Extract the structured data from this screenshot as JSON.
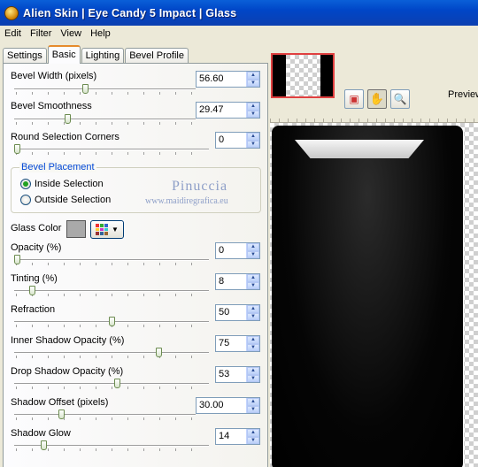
{
  "window": {
    "title": "Alien Skin | Eye Candy 5 Impact | Glass"
  },
  "menu": [
    "Edit",
    "Filter",
    "View",
    "Help"
  ],
  "tabs": [
    "Settings",
    "Basic",
    "Lighting",
    "Bevel Profile"
  ],
  "active_tab": "Basic",
  "controls": {
    "bevel_width": {
      "label": "Bevel Width (pixels)",
      "value": "56.60",
      "level": 0.39
    },
    "bevel_smoothness": {
      "label": "Bevel Smoothness",
      "value": "29.47",
      "level": 0.29
    },
    "round_corners": {
      "label": "Round Selection Corners",
      "value": "0",
      "level": 0.0
    },
    "opacity": {
      "label": "Opacity (%)",
      "value": "0",
      "level": 0.0
    },
    "tinting": {
      "label": "Tinting (%)",
      "value": "8",
      "level": 0.08
    },
    "refraction": {
      "label": "Refraction",
      "value": "50",
      "level": 0.5
    },
    "inner_shadow": {
      "label": "Inner Shadow Opacity (%)",
      "value": "75",
      "level": 0.75
    },
    "drop_shadow": {
      "label": "Drop Shadow Opacity (%)",
      "value": "53",
      "level": 0.53
    },
    "shadow_offset": {
      "label": "Shadow Offset (pixels)",
      "value": "30.00",
      "level": 0.25
    },
    "shadow_glow": {
      "label": "Shadow Glow",
      "value": "14",
      "level": 0.14
    }
  },
  "bevel_placement": {
    "title": "Bevel Placement",
    "inside": "Inside Selection",
    "outside": "Outside Selection",
    "selected": "inside"
  },
  "glass_color": {
    "label": "Glass Color",
    "color": "#a9a9a9"
  },
  "watermark": {
    "name": "Pinuccia",
    "url": "www.maidiregrafica.eu"
  },
  "preview": {
    "label": "Preview",
    "tools": [
      "preview-toggle-icon",
      "hand-icon",
      "zoom-icon"
    ]
  },
  "colors": {
    "title_bar": "#0054e3",
    "tab_accent": "#e68b2c",
    "group_title": "#0046d5"
  }
}
